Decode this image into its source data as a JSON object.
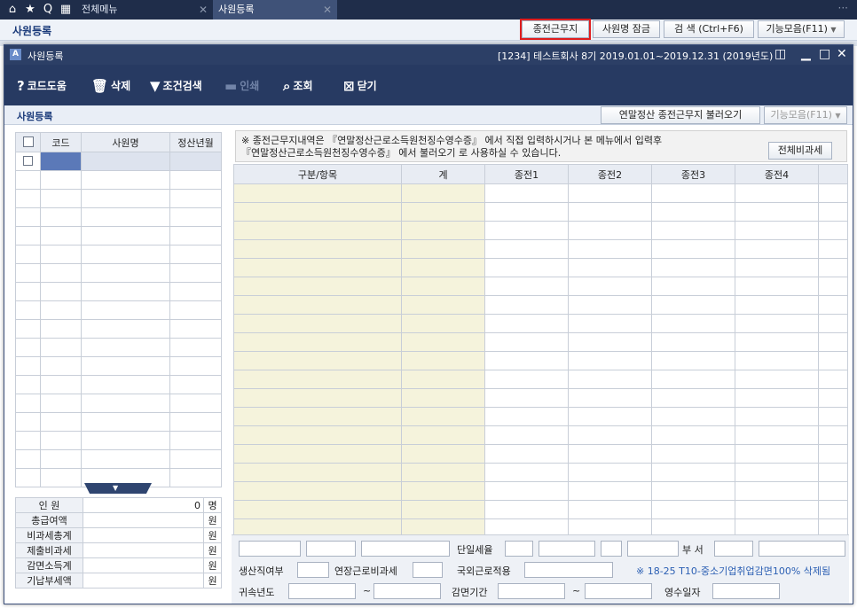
{
  "topbar": {
    "tabs": [
      {
        "label": "전체메뉴",
        "active": false
      },
      {
        "label": "사원등록",
        "active": true
      }
    ],
    "icons": [
      "home-icon",
      "star-icon",
      "search-icon",
      "menu-grid-icon"
    ]
  },
  "background_window": {
    "title": "사원등록",
    "buttons": {
      "prev_work": "종전근무지",
      "lock_name": "사원명 잠금",
      "search": "검  색 (Ctrl+F6)",
      "functions": "기능모음(F11)"
    }
  },
  "modal": {
    "title": "사원등록",
    "company_info": "[1234] 테스트회사 8기 2019.01.01~2019.12.31 (2019년도)",
    "toolbar": {
      "code_help": "코드도움",
      "delete": "삭제",
      "condition_search": "조건검색",
      "print": "인쇄",
      "inquiry": "조회",
      "close": "닫기"
    },
    "subbar": {
      "title": "사원등록",
      "load_button": "연말정산 종전근무지 불러오기",
      "functions_button": "기능모음(F11)"
    },
    "left_grid": {
      "headers": [
        "코드",
        "사원명",
        "정산년월"
      ]
    },
    "summary": [
      {
        "label": "인    원",
        "value": "0",
        "unit": "명"
      },
      {
        "label": "총급여액",
        "value": "",
        "unit": "원"
      },
      {
        "label": "비과세총계",
        "value": "",
        "unit": "원"
      },
      {
        "label": "제출비과세",
        "value": "",
        "unit": "원"
      },
      {
        "label": "감면소득계",
        "value": "",
        "unit": "원"
      },
      {
        "label": "기납부세액",
        "value": "",
        "unit": "원"
      }
    ],
    "notice": {
      "line1": "※ 종전근무지내역은 『연말정산근로소득원천징수영수증』 에서 직접 입력하시거나 본 메뉴에서 입력후",
      "line2": "『연말정산근로소득원천징수영수증』 에서 불러오기 로 사용하실 수 있습니다.",
      "all_nontax_button": "전체비과세"
    },
    "right_grid": {
      "headers": [
        "구분/항목",
        "계",
        "종전1",
        "종전2",
        "종전3",
        "종전4",
        ""
      ]
    },
    "bottom_form": {
      "single_tax_rate": "단일세율",
      "department": "부 서",
      "production_worker": "생산직여부",
      "extended_work_nontax": "연장근로비과세",
      "overseas_work": "국외근로적용",
      "note": "※ 18-25 T10-중소기업취업감면100%  삭제됨",
      "tax_year": "귀속년도",
      "tilde": "~",
      "reduction_period": "감면기간",
      "receipt_date": "영수일자"
    }
  }
}
